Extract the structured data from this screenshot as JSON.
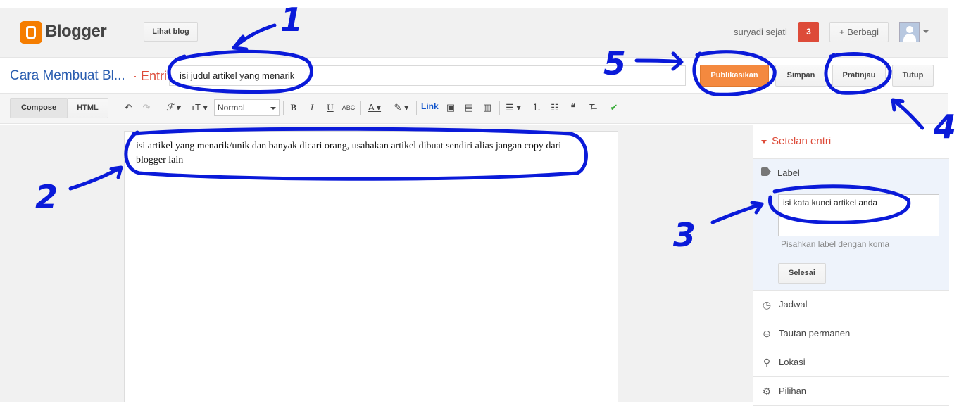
{
  "header": {
    "brand": "Blogger",
    "view_blog": "Lihat blog",
    "user_name": "suryadi sejati",
    "notification_count": "3",
    "share": "+ Berbagi"
  },
  "titlebar": {
    "blog_name": "Cara Membuat Bl...",
    "section": "· Entri",
    "post_title": "isi judul artikel yang menarik",
    "publish": "Publikasikan",
    "save": "Simpan",
    "preview": "Pratinjau",
    "close": "Tutup"
  },
  "toolbar": {
    "compose": "Compose",
    "html": "HTML",
    "font_size": "Normal",
    "link": "Link"
  },
  "editor": {
    "body": "isi artikel yang menarik/unik dan banyak dicari orang, usahakan artikel dibuat sendiri alias jangan copy dari blogger lain"
  },
  "sidebar": {
    "title": "Setelan entri",
    "label": {
      "title": "Label",
      "value": "isi kata kunci artikel anda",
      "hint": "Pisahkan label dengan koma",
      "done": "Selesai"
    },
    "items": [
      {
        "label": "Jadwal",
        "icon": "clock-icon"
      },
      {
        "label": "Tautan permanen",
        "icon": "link-icon"
      },
      {
        "label": "Lokasi",
        "icon": "pin-icon"
      },
      {
        "label": "Pilihan",
        "icon": "gear-icon"
      }
    ]
  },
  "annotations": {
    "n1": "1",
    "n2": "2",
    "n3": "3",
    "n4": "4",
    "n5": "5"
  },
  "colors": {
    "accent": "#f4893f",
    "annotation": "#0a1ad9",
    "link": "#2a5db0"
  }
}
